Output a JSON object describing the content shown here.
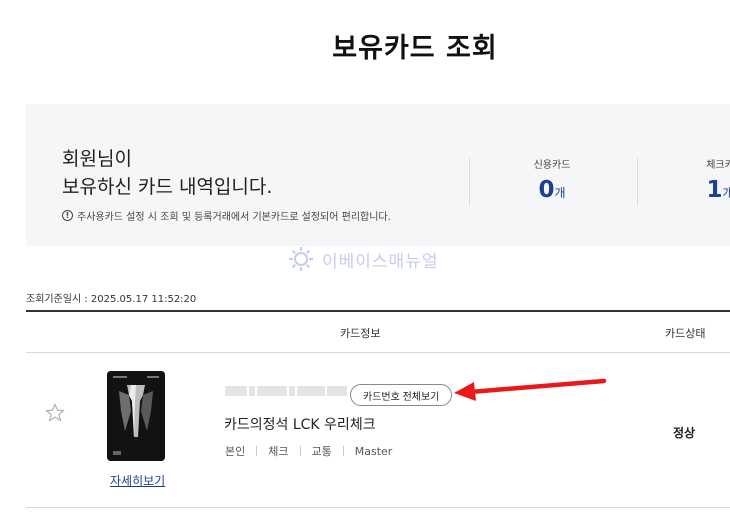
{
  "page": {
    "title": "보유카드 조회"
  },
  "summary": {
    "greeting_line1": "회원님이",
    "greeting_line2": "보유하신 카드 내역입니다.",
    "notice": "주사용카드 설정 시 조회 및 등록거래에서 기본카드로 설정되어 편리합니다.",
    "credit": {
      "label": "신용카드",
      "count": "0",
      "unit": "개"
    },
    "check": {
      "label": "체크카",
      "count": "1",
      "unit": "개"
    }
  },
  "watermark": {
    "text": "이베이스매뉴얼"
  },
  "timestamp": "조회기준일시 : 2025.05.17 11:52:20",
  "table": {
    "headers": {
      "info": "카드정보",
      "status": "카드상태"
    },
    "rows": [
      {
        "reveal_label": "카드번호 전체보기",
        "name": "카드의정석 LCK 우리체크",
        "tags": [
          "본인",
          "체크",
          "교통",
          "Master"
        ],
        "detail_label": "자세히보기",
        "status": "정상"
      }
    ]
  },
  "colors": {
    "accent": "#1c3f94",
    "annotation": "#e8191b",
    "panel": "#f5f6f8"
  },
  "icons": [
    "alert-circle-icon",
    "star-outline-icon",
    "watermark-logo-icon",
    "annotation-arrow-icon"
  ]
}
